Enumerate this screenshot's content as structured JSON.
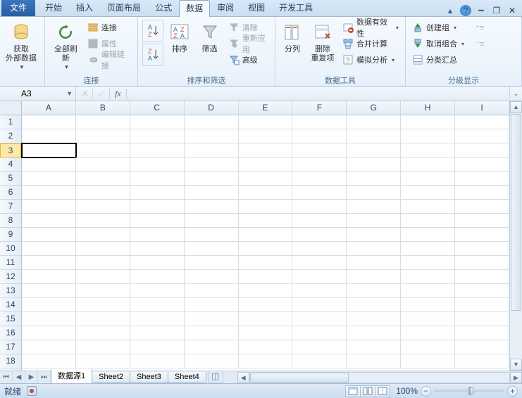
{
  "tabs": {
    "file": "文件",
    "items": [
      "开始",
      "插入",
      "页面布局",
      "公式",
      "数据",
      "审阅",
      "视图",
      "开发工具"
    ],
    "activeIndex": 4
  },
  "ribbon": {
    "group_getdata": {
      "get_data": "获取\n外部数据",
      "label": ""
    },
    "group_conn": {
      "refresh_all": "全部刷新",
      "connections": "连接",
      "properties": "属性",
      "edit_links": "编辑链接",
      "label": "连接"
    },
    "group_sort": {
      "sort_asc": "A↓Z",
      "sort_desc": "Z↓A",
      "sort": "排序",
      "filter": "筛选",
      "clear": "清除",
      "reapply": "重新应用",
      "advanced": "高级",
      "label": "排序和筛选"
    },
    "group_tools": {
      "text_to_cols": "分列",
      "remove_dup": "删除\n重复项",
      "validation": "数据有效性",
      "consolidate": "合并计算",
      "whatif": "模拟分析",
      "label": "数据工具"
    },
    "group_outline": {
      "group": "创建组",
      "ungroup": "取消组合",
      "subtotal": "分类汇总",
      "label": "分级显示"
    }
  },
  "namebox": {
    "value": "A3"
  },
  "fx_label": "fx",
  "columns": [
    "A",
    "B",
    "C",
    "D",
    "E",
    "F",
    "G",
    "H",
    "I"
  ],
  "rows": [
    "1",
    "2",
    "3",
    "4",
    "5",
    "6",
    "7",
    "8",
    "9",
    "10",
    "11",
    "12",
    "13",
    "14",
    "15",
    "16",
    "17",
    "18"
  ],
  "activeRow": "3",
  "sheets": {
    "items": [
      "数据源1",
      "Sheet2",
      "Sheet3",
      "Sheet4"
    ],
    "activeIndex": 0
  },
  "status": {
    "ready": "就绪",
    "zoom": "100%"
  }
}
